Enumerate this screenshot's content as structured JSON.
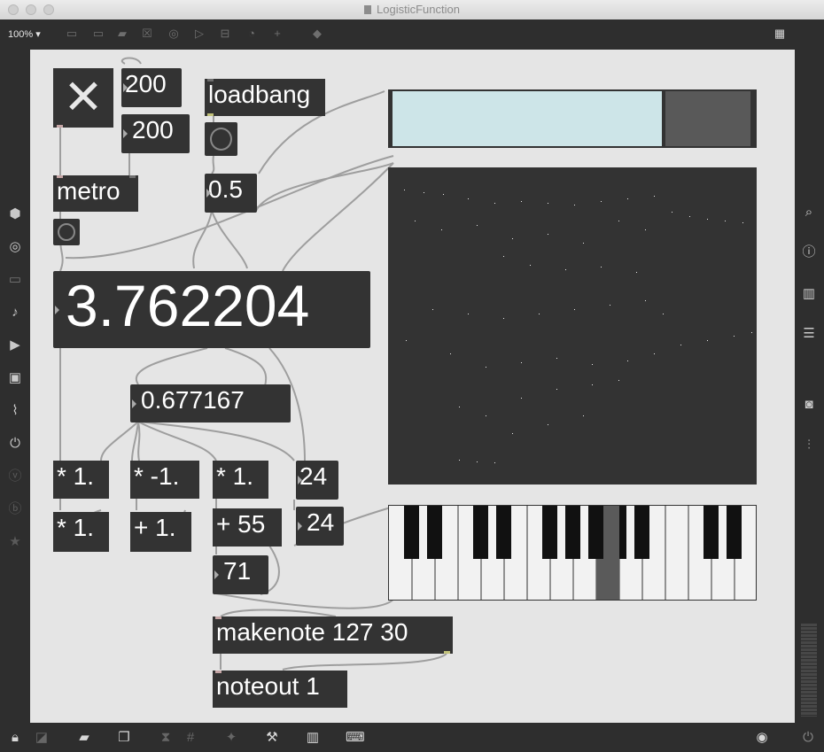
{
  "window": {
    "title": "LogisticFunction"
  },
  "toolbar": {
    "zoom": "100%"
  },
  "patch": {
    "toggle_symbol": "✕",
    "num_200_a": "200",
    "num_200_b": "200",
    "loadbang": "loadbang",
    "metro": "metro",
    "num_05": "0.5",
    "big_num": "3.762204",
    "num_small": "0.677167",
    "mul1_a": "* 1.",
    "mul_neg1": "* -1.",
    "mul1_c": "* 1.",
    "mul1_b": "* 1.",
    "add1": "+ 1.",
    "add55": "+ 55",
    "num_24_a": "24",
    "num_24_b": "24",
    "num_71": "71",
    "makenote": "makenote 127 30",
    "noteout": "noteout 1"
  },
  "slider": {
    "value": 0.75,
    "track_color": "#cde5e8",
    "knob_color": "#595959"
  },
  "keyboard": {
    "highlighted_key": "F#"
  },
  "colors": {
    "canvas": "#e5e5e5",
    "object": "#333333",
    "wire": "#9e9e9e"
  }
}
